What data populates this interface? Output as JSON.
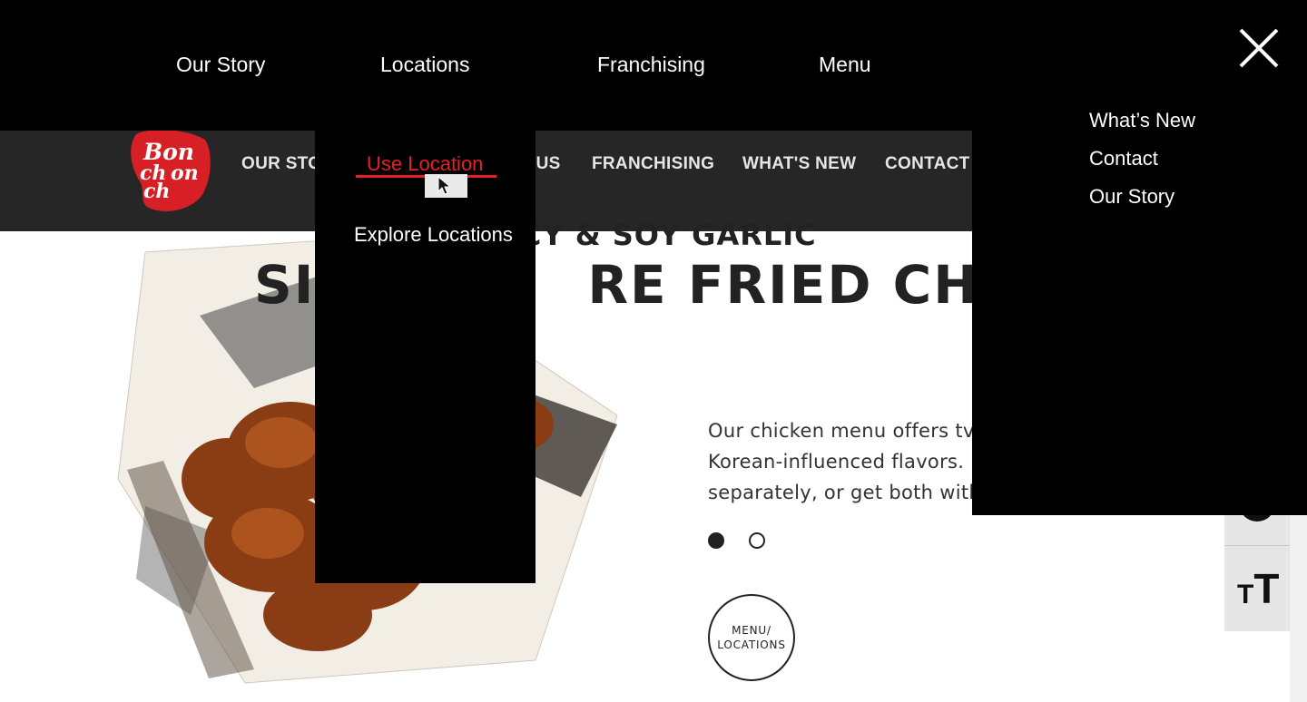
{
  "site_nav": {
    "items": [
      "OUR STO",
      "IUS",
      "FRANCHISING",
      "WHAT'S NEW",
      "CONTACT"
    ]
  },
  "hero": {
    "subtitle": "ICY & SOY GARLIC",
    "title": "SI",
    "title_right": "RE FRIED CHICK",
    "description_lines": [
      "Our chicken menu offers tv",
      "Korean-influenced flavors.",
      "separately, or get both with"
    ]
  },
  "carousel": {
    "dot_count": 2,
    "active_index": 0
  },
  "menu_locations_button": {
    "line1": "MENU/",
    "line2": "LOCATIONS"
  },
  "overlay_nav": {
    "items": [
      "Our Story",
      "Locations",
      "Franchising",
      "Menu"
    ]
  },
  "locations_dropdown": {
    "items": [
      "Use Location",
      "Explore Locations"
    ],
    "active": "Use Location"
  },
  "right_menu": {
    "items": [
      "What’s New",
      "Contact",
      "Our Story"
    ]
  },
  "colors": {
    "accent_red": "#e4202a",
    "header_bg": "#262626",
    "overlay_bg": "#000000"
  },
  "icons": {
    "close": "close-icon",
    "text_size": "text-size-icon",
    "cursor": "mouse-cursor-icon"
  },
  "a11y": {
    "text_size_glyph_small": "T",
    "text_size_glyph_large": "T"
  }
}
